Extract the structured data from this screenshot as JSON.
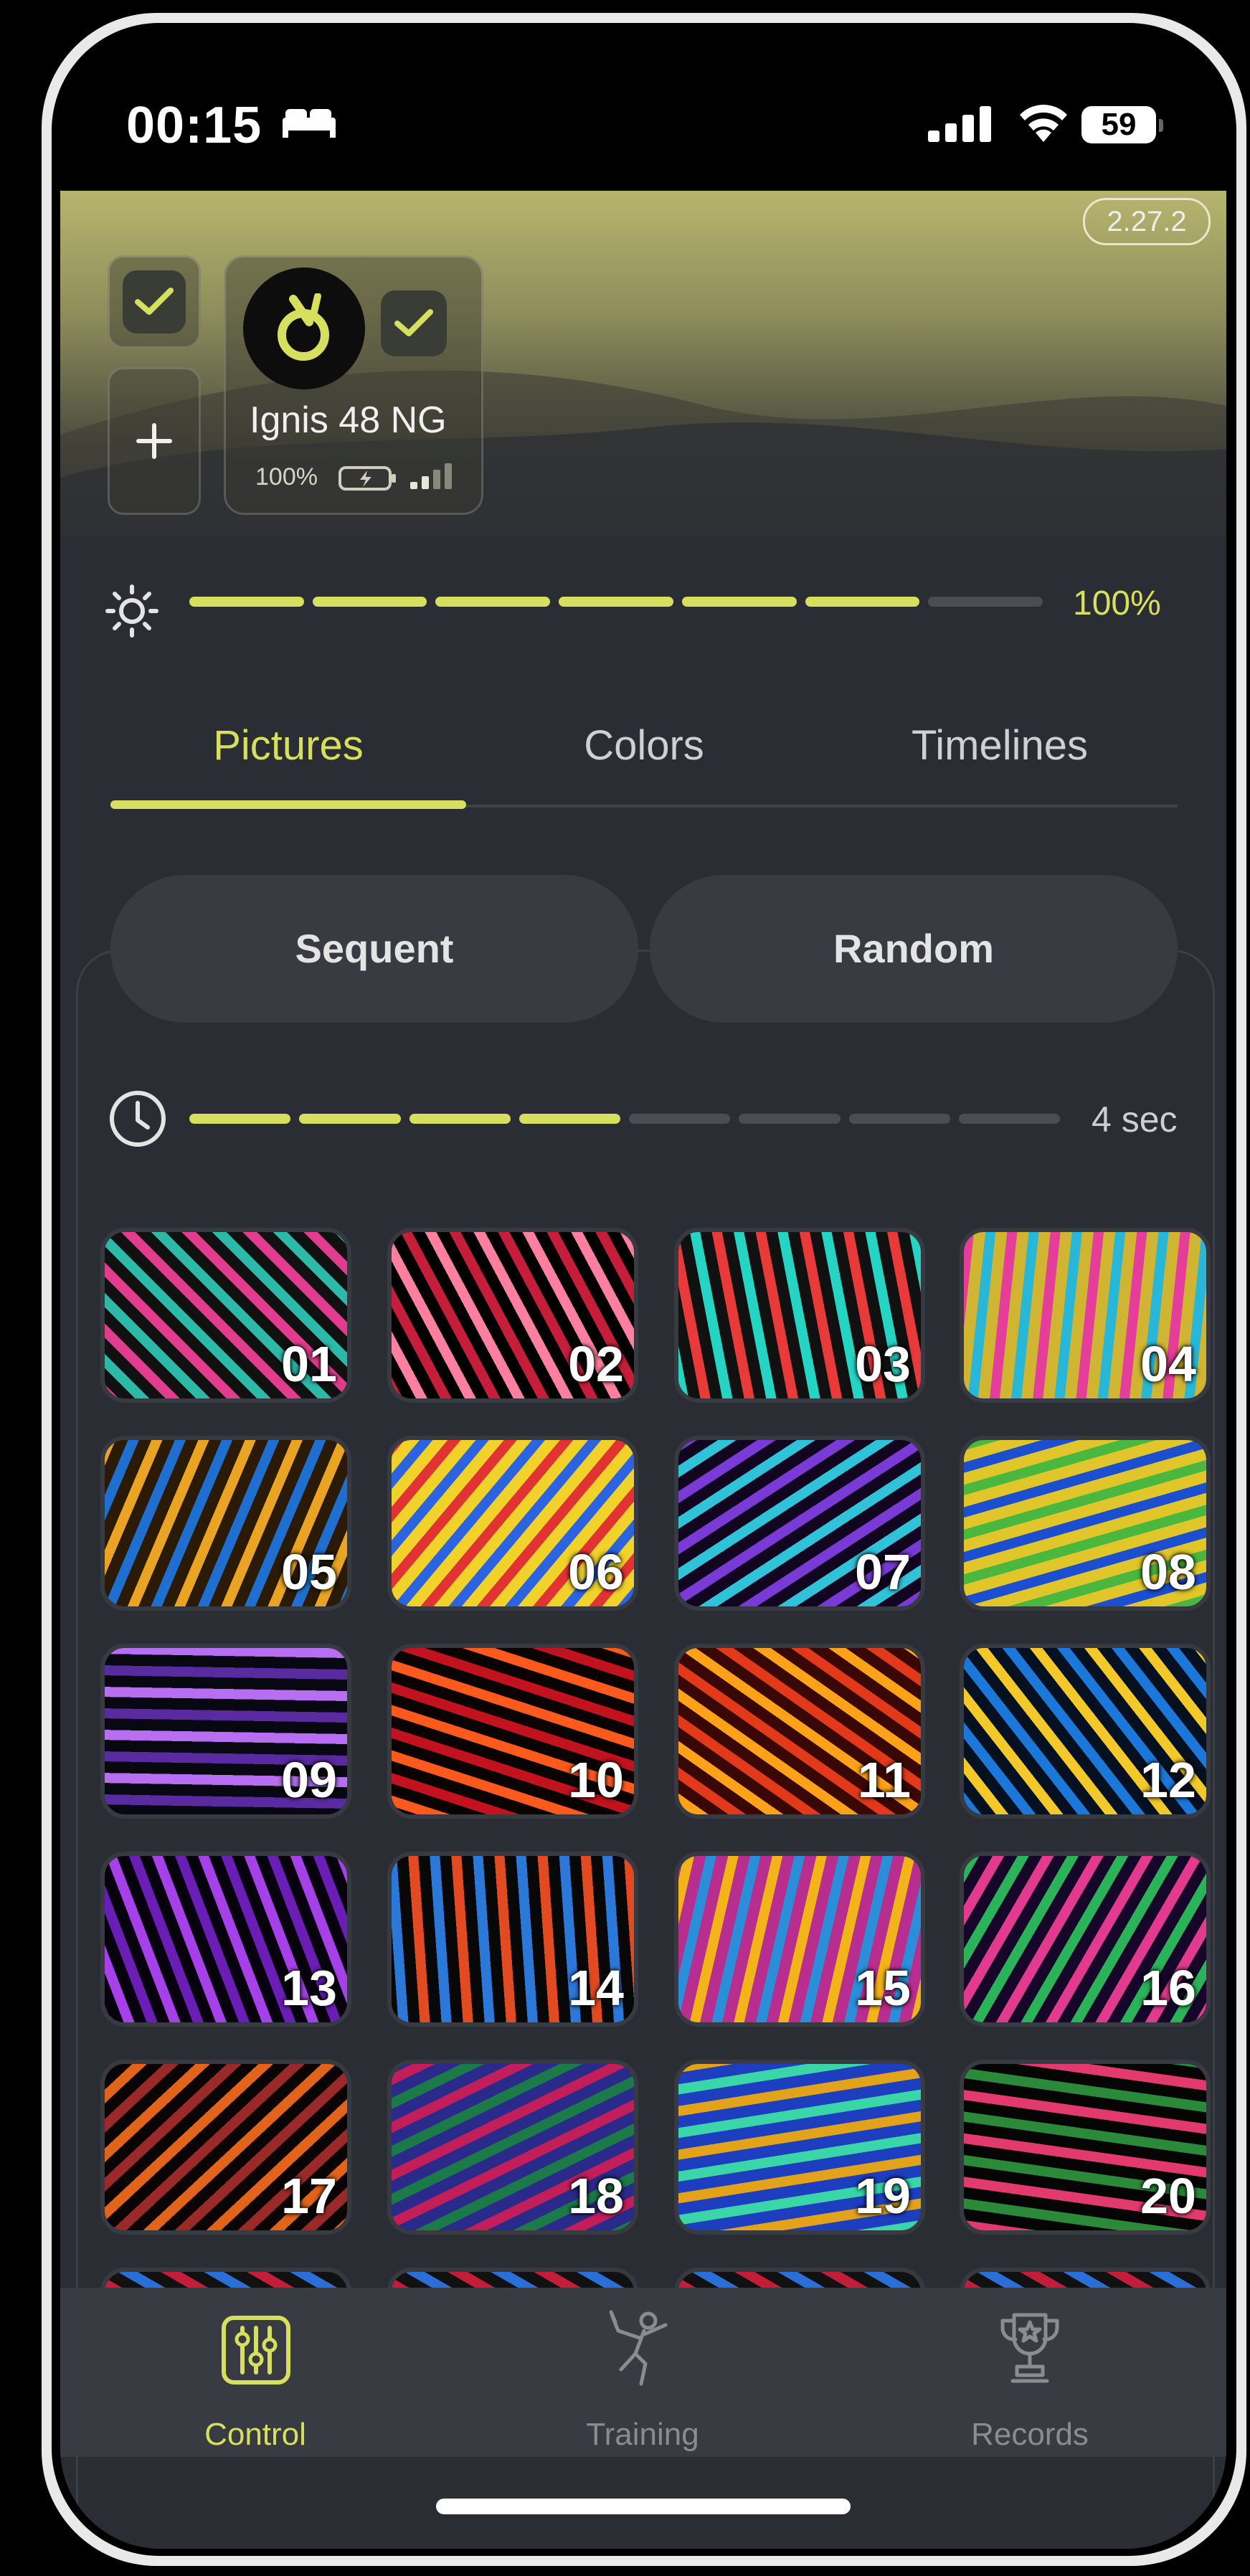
{
  "status_bar": {
    "time": "00:15",
    "battery": "59"
  },
  "app": {
    "version": "2.27.2"
  },
  "device": {
    "name": "Ignis 48 NG",
    "battery": "100%"
  },
  "brightness": {
    "value": "100%",
    "level": 6,
    "segments": 7
  },
  "tabs": [
    {
      "label": "Pictures",
      "active": true
    },
    {
      "label": "Colors",
      "active": false
    },
    {
      "label": "Timelines",
      "active": false
    }
  ],
  "modes": {
    "sequent": "Sequent",
    "random": "Random"
  },
  "timer": {
    "value": "4 sec",
    "level": 4,
    "segments": 8
  },
  "pictures": [
    "01",
    "02",
    "03",
    "04",
    "05",
    "06",
    "07",
    "08",
    "09",
    "10",
    "11",
    "12",
    "13",
    "14",
    "15",
    "16",
    "17",
    "18",
    "19",
    "20"
  ],
  "nav": [
    {
      "label": "Control",
      "icon": "sliders-icon",
      "active": true
    },
    {
      "label": "Training",
      "icon": "dancer-icon",
      "active": false
    },
    {
      "label": "Records",
      "icon": "trophy-icon",
      "active": false
    }
  ],
  "colors": {
    "accent": "#d7df5e",
    "background": "#2a2d33",
    "muted": "#8a8c90"
  }
}
